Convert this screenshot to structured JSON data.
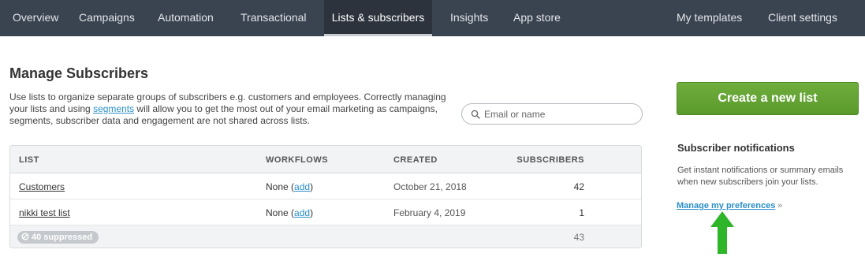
{
  "nav": {
    "items": [
      {
        "label": "Overview",
        "active": false
      },
      {
        "label": "Campaigns",
        "active": false
      },
      {
        "label": "Automation",
        "active": false
      },
      {
        "label": "Transactional",
        "active": false
      },
      {
        "label": "Lists & subscribers",
        "active": true
      },
      {
        "label": "Insights",
        "active": false
      },
      {
        "label": "App store",
        "active": false
      }
    ],
    "right_items": [
      {
        "label": "My templates"
      },
      {
        "label": "Client settings"
      }
    ]
  },
  "page": {
    "title": "Manage Subscribers",
    "intro_before_link": "Use lists to organize separate groups of subscribers e.g. customers and employees. Correctly managing your lists and using ",
    "intro_link": "segments",
    "intro_after_link": " will allow you to get the most out of your email marketing as campaigns, segments, subscriber data and engagement are not shared across lists."
  },
  "search": {
    "placeholder": "Email or name",
    "value": ""
  },
  "table": {
    "headers": [
      "LIST",
      "WORKFLOWS",
      "CREATED",
      "SUBSCRIBERS"
    ],
    "rows": [
      {
        "list": "Customers",
        "workflows": "None",
        "workflows_link": "add",
        "created": "October 21, 2018",
        "subscribers": "42"
      },
      {
        "list": "nikki test list",
        "workflows": "None",
        "workflows_link": "add",
        "created": "February 4, 2019",
        "subscribers": "1"
      }
    ],
    "footer": {
      "suppressed_label": "40 suppressed",
      "total": "43"
    }
  },
  "sidebar": {
    "create_button": "Create a new list",
    "notifications_title": "Subscriber notifications",
    "notifications_desc": "Get instant notifications or summary emails when new subscribers join your lists.",
    "manage_link": "Manage my preferences",
    "manage_suffix": "»"
  },
  "colors": {
    "nav_bg": "#3a4350",
    "link": "#2a8fc9",
    "create_button": "#62a233",
    "arrow": "#2fb52a"
  }
}
